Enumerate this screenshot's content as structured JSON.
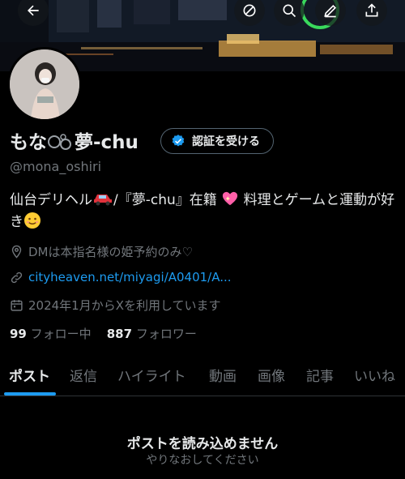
{
  "profile": {
    "name": "もな",
    "name_suffix": "夢-chu",
    "verify_label": "認証を受ける",
    "handle": "@mona_oshiri",
    "bio_part1": "仙台デリヘル",
    "bio_part2": "/『夢-chu』在籍",
    "bio_part3": "料理とゲームと運動が好き",
    "location": "DMは本指名様の姫予約のみ♡",
    "website": "cityheaven.net/miyagi/A0401/A...",
    "joined": "2024年1月からXを利用しています",
    "following_count": "99",
    "following_label": "フォロー中",
    "followers_count": "887",
    "followers_label": "フォロワー"
  },
  "tabs": [
    "ポスト",
    "返信",
    "ハイライト",
    "動画",
    "画像",
    "記事",
    "いいね"
  ],
  "empty_state": {
    "title": "ポストを読み込めません",
    "subtitle": "やりなおしてください"
  },
  "colors": {
    "accent": "#1d9bf0",
    "text": "#e7e9ea",
    "muted": "#71767b",
    "background": "#000000"
  },
  "icons": [
    "back-arrow-icon",
    "mute-icon",
    "search-icon",
    "edit-icon",
    "share-icon",
    "location-icon",
    "link-icon",
    "calendar-icon",
    "verified-badge-icon"
  ]
}
